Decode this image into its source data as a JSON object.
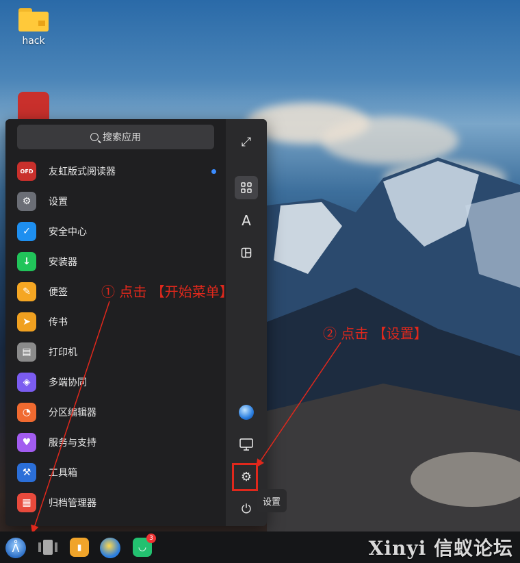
{
  "desktop": {
    "icons": [
      {
        "label": "hack",
        "icon": "folder-icon"
      },
      {
        "label": "",
        "icon": "ofd-reader-icon"
      }
    ]
  },
  "start_menu": {
    "search": {
      "placeholder": "搜索应用",
      "icon": "search-icon"
    },
    "apps": [
      {
        "label": "友虹版式阅读器",
        "icon": "ofd-reader-icon",
        "color": "#c9302c",
        "new": true
      },
      {
        "label": "设置",
        "icon": "settings-icon",
        "color": "#6b6e76"
      },
      {
        "label": "安全中心",
        "icon": "shield-icon",
        "color": "#1e8ff0"
      },
      {
        "label": "安装器",
        "icon": "download-icon",
        "color": "#21c45a"
      },
      {
        "label": "便签",
        "icon": "note-icon",
        "color": "#f5a623"
      },
      {
        "label": "传书",
        "icon": "send-icon",
        "color": "#f0a020"
      },
      {
        "label": "打印机",
        "icon": "printer-icon",
        "color": "#8b8b8b"
      },
      {
        "label": "多端协同",
        "icon": "collaboration-icon",
        "color": "#7b5cf0"
      },
      {
        "label": "分区编辑器",
        "icon": "partition-icon",
        "color": "#f06a30"
      },
      {
        "label": "服务与支持",
        "icon": "heart-icon",
        "color": "#a25cf0"
      },
      {
        "label": "工具箱",
        "icon": "toolbox-icon",
        "color": "#2b6fd8"
      },
      {
        "label": "归档管理器",
        "icon": "archive-icon",
        "color": "#e84a3c"
      }
    ],
    "sidebar": [
      {
        "name": "fullscreen-icon",
        "glyph": "⤢"
      },
      {
        "name": "grid-view-icon",
        "glyph": "▦",
        "active": true
      },
      {
        "name": "letter-sort-icon",
        "glyph": "A"
      },
      {
        "name": "category-icon",
        "glyph": "◫"
      },
      {
        "name": "browser-icon",
        "glyph": "●"
      },
      {
        "name": "desktop-icon",
        "glyph": "🖵"
      },
      {
        "name": "gear-icon",
        "glyph": "⚙"
      },
      {
        "name": "power-icon",
        "glyph": "⏻"
      }
    ]
  },
  "tooltip": {
    "text": "设置"
  },
  "annotations": {
    "step1": "① 点击 【开始菜单】",
    "step2": "② 点击 【设置】"
  },
  "taskbar": {
    "badge_count": "3"
  },
  "watermark": "Xinyi 信蚁论坛"
}
